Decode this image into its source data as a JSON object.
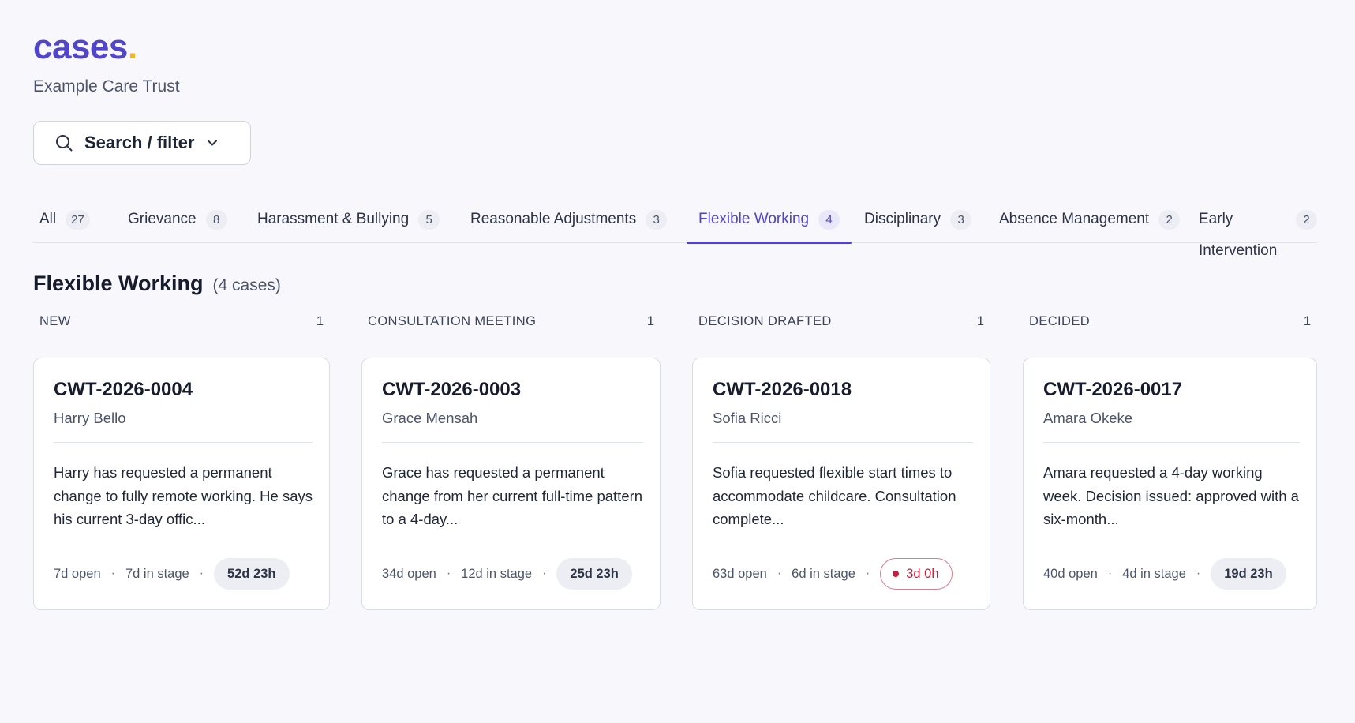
{
  "brand": {
    "word": "cases",
    "dot": ".",
    "org": "Example Care Trust"
  },
  "search": {
    "label": "Search / filter",
    "icon": "search-icon",
    "chevron": "chevron-down-icon"
  },
  "tabs": [
    {
      "label": "All",
      "count": "27"
    },
    {
      "label": "Grievance",
      "count": "8"
    },
    {
      "label": "Harassment & Bullying",
      "count": "5"
    },
    {
      "label": "Reasonable Adjustments",
      "count": "3"
    },
    {
      "label": "Flexible Working",
      "count": "4",
      "active": true
    },
    {
      "label": "Disciplinary",
      "count": "3"
    },
    {
      "label": "Absence Management",
      "count": "2"
    },
    {
      "label": "Early Intervention",
      "count": "2"
    }
  ],
  "section": {
    "title": "Flexible Working",
    "subtitle": "(4 cases)"
  },
  "columns": [
    {
      "name": "NEW",
      "count": "1",
      "card": {
        "id": "CWT-2026-0004",
        "person": "Harry Bello",
        "description": "Harry has requested a permanent change to fully remote working. He says his current 3-day offic...",
        "open": "7d open",
        "stage": "7d in stage",
        "timer": "52d 23h",
        "timer_alert": false
      }
    },
    {
      "name": "CONSULTATION MEETING",
      "count": "1",
      "card": {
        "id": "CWT-2026-0003",
        "person": "Grace Mensah",
        "description": "Grace has requested a permanent change from her current full-time pattern to a 4-day...",
        "open": "34d open",
        "stage": "12d in stage",
        "timer": "25d 23h",
        "timer_alert": false
      }
    },
    {
      "name": "DECISION DRAFTED",
      "count": "1",
      "card": {
        "id": "CWT-2026-0018",
        "person": "Sofia Ricci",
        "description": "Sofia requested flexible start times to accommodate childcare. Consultation complete...",
        "open": "63d open",
        "stage": "6d in stage",
        "timer": "3d 0h",
        "timer_alert": true
      }
    },
    {
      "name": "DECIDED",
      "count": "1",
      "card": {
        "id": "CWT-2026-0017",
        "person": "Amara Okeke",
        "description": "Amara requested a 4-day working week. Decision issued: approved with a six-month...",
        "open": "40d open",
        "stage": "4d in stage",
        "timer": "19d 23h",
        "timer_alert": false
      }
    }
  ],
  "meta_separator": "·",
  "colors": {
    "accent": "#4f45c9",
    "brand_dot": "#f2b824",
    "alert": "#c81e3c",
    "background": "#f7f7fc"
  }
}
